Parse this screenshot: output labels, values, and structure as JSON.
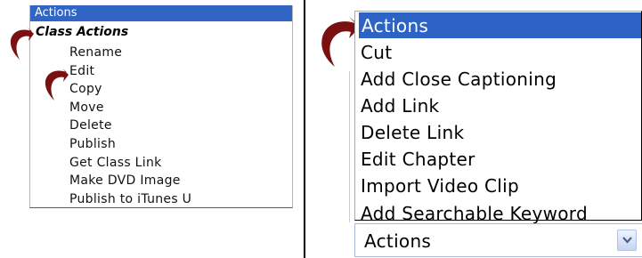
{
  "left_menu": {
    "header": "Actions",
    "group_label": "Class Actions",
    "items": [
      "Rename",
      "Edit",
      "Copy",
      "Move",
      "Delete",
      "Publish",
      "Get Class Link",
      "Make DVD Image",
      "Publish to iTunes U"
    ]
  },
  "right_menu": {
    "header": "Actions",
    "items": [
      "Cut",
      "Add Close Captioning",
      "Add Link",
      "Delete Link",
      "Edit Chapter",
      "Import Video Clip",
      "Add Searchable Keyword"
    ],
    "selected_value": "Actions"
  },
  "colors": {
    "highlight": "#3165c4",
    "arrow": "#7a1010"
  },
  "icons": {
    "arrow_pointer": "curved-arrow-icon",
    "dropdown": "chevron-down-icon"
  }
}
